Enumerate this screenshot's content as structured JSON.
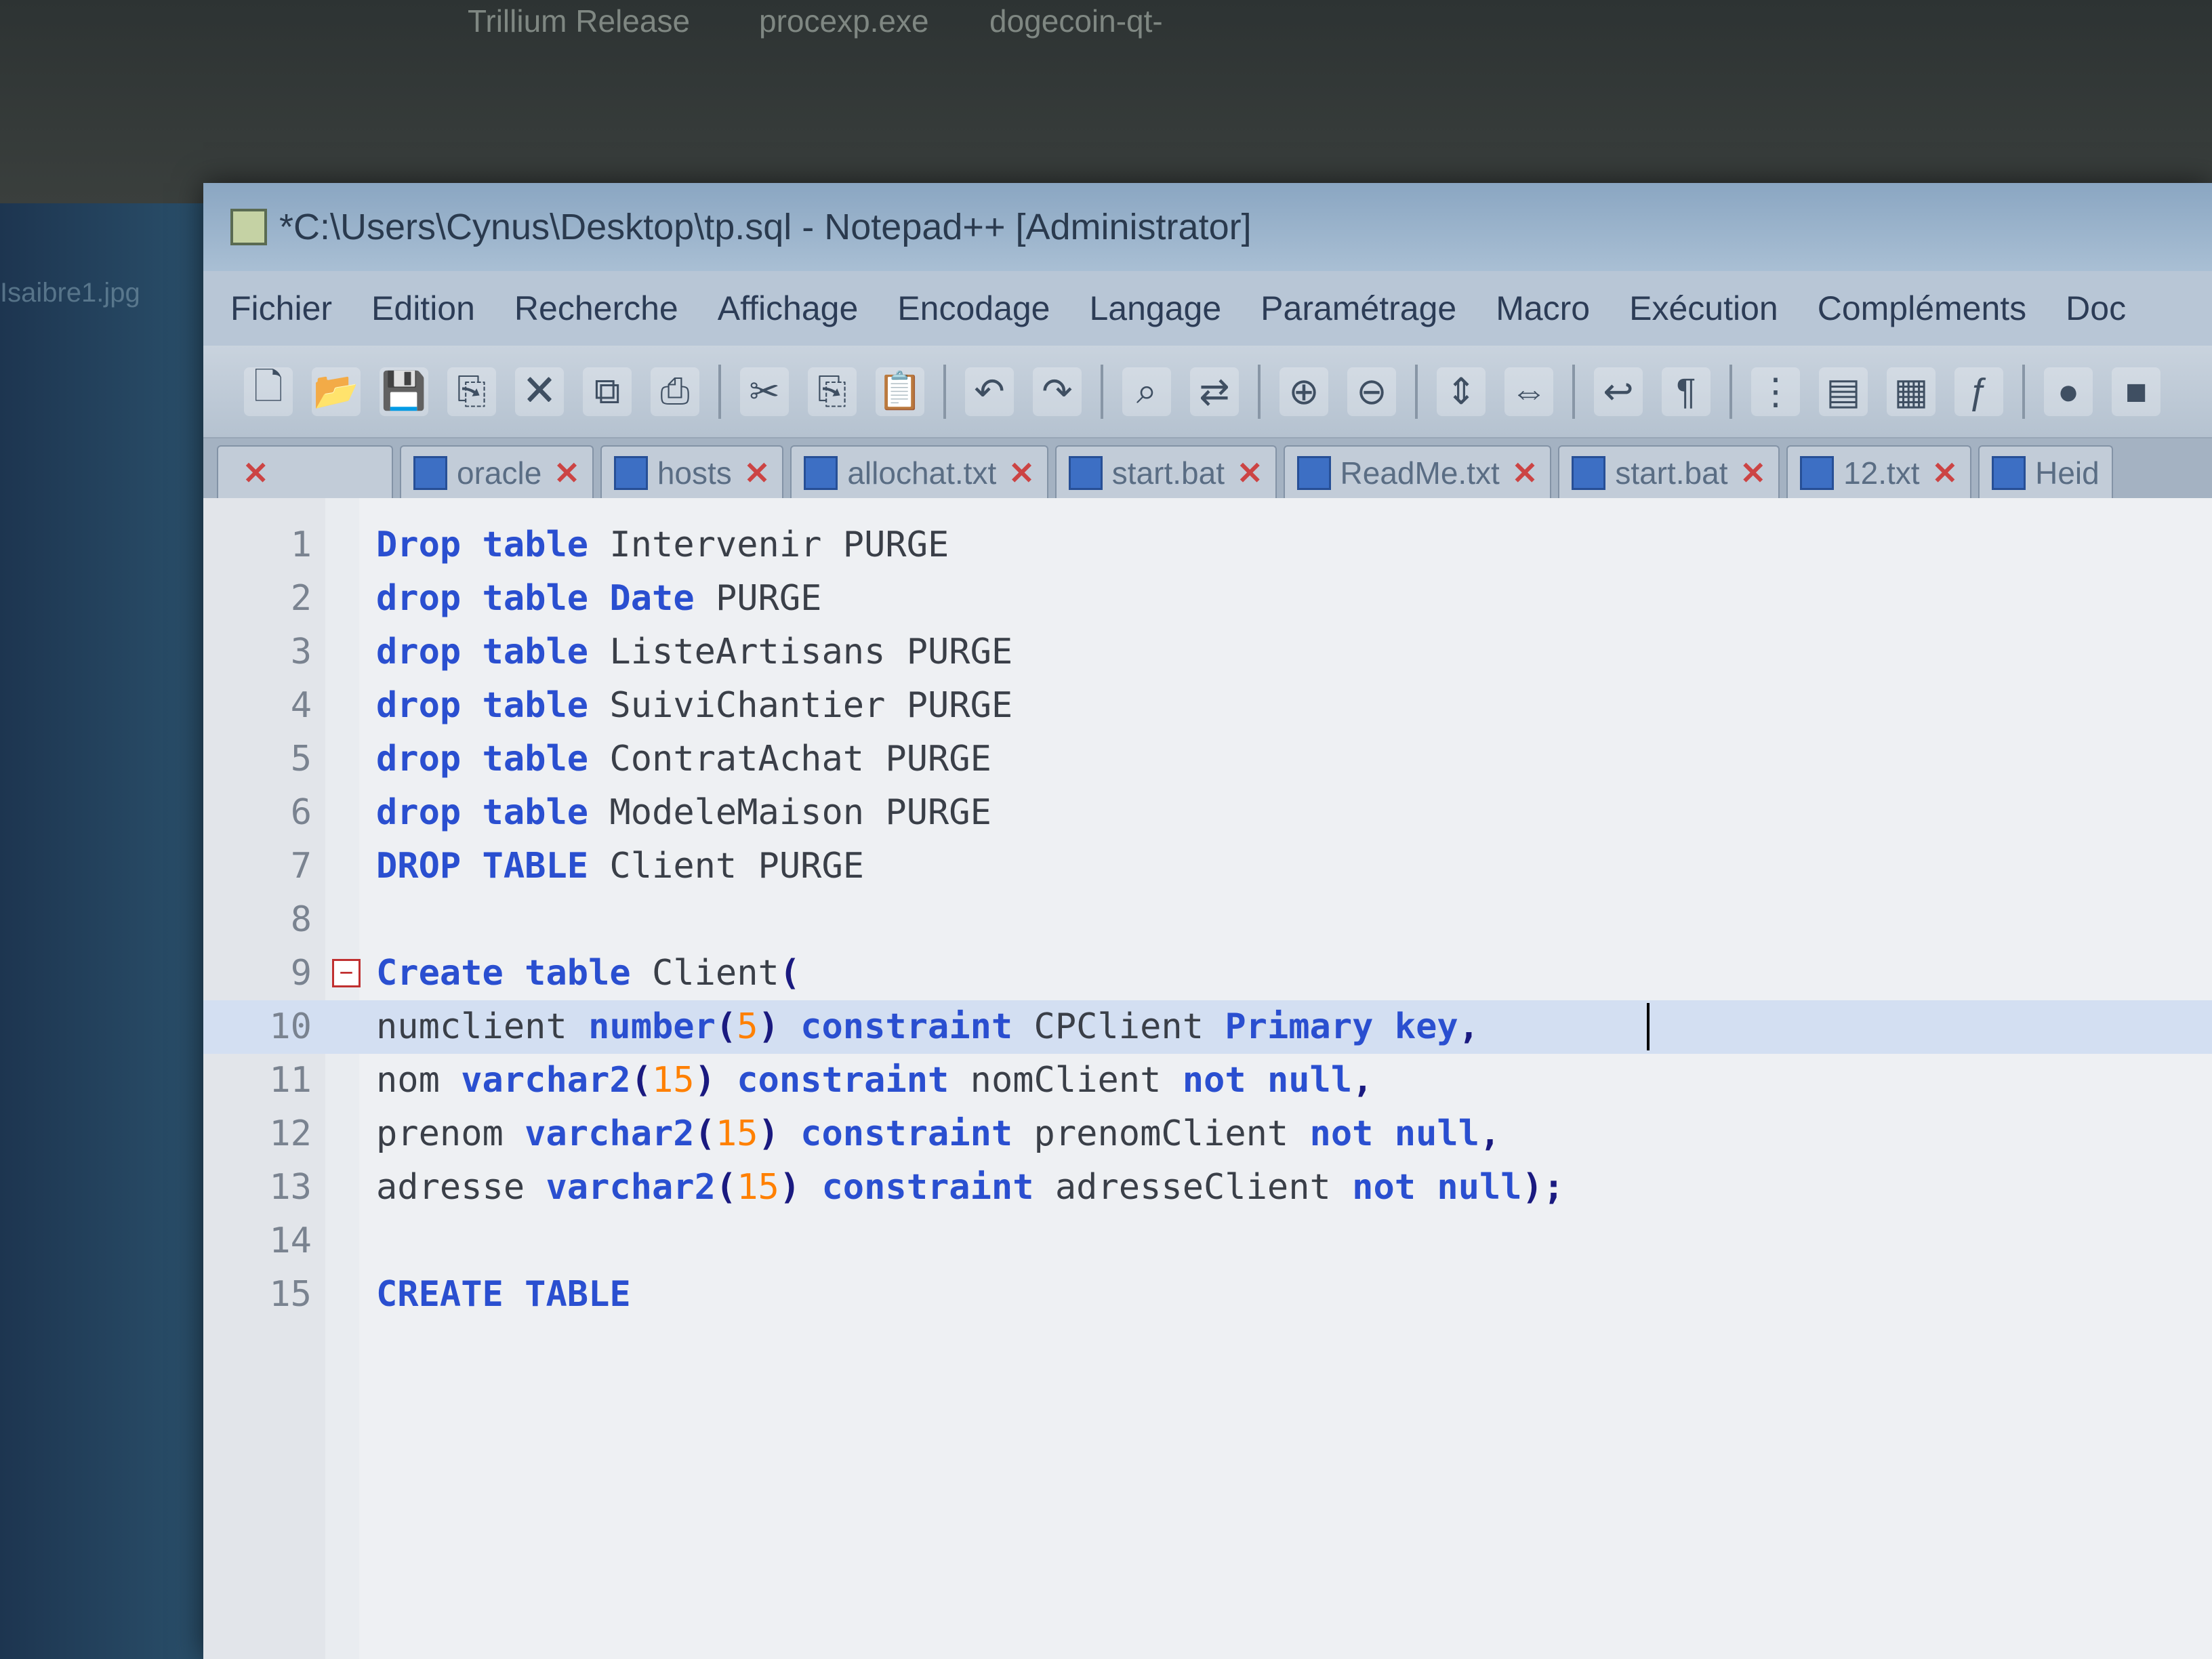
{
  "desktop": {
    "taskbar_items": [
      "Trillium Release",
      "procexp.exe",
      "dogecoin-qt-"
    ],
    "left_file": "Isaibre1.jpg"
  },
  "window": {
    "title": "*C:\\Users\\Cynus\\Desktop\\tp.sql - Notepad++ [Administrator]"
  },
  "menu": [
    "Fichier",
    "Edition",
    "Recherche",
    "Affichage",
    "Encodage",
    "Langage",
    "Paramétrage",
    "Macro",
    "Exécution",
    "Compléments",
    "Doc"
  ],
  "toolbar": {
    "icons": [
      "new-file-icon",
      "open-file-icon",
      "save-icon",
      "save-all-icon",
      "close-icon",
      "close-all-icon",
      "print-icon",
      "cut-icon",
      "copy-icon",
      "paste-icon",
      "undo-icon",
      "redo-icon",
      "find-icon",
      "replace-icon",
      "zoom-in-icon",
      "zoom-out-icon",
      "sync-v-icon",
      "sync-h-icon",
      "word-wrap-icon",
      "show-all-chars-icon",
      "indent-guide-icon",
      "udl-icon",
      "doc-map-icon",
      "function-list-icon",
      "record-macro-icon",
      "stop-macro-icon"
    ]
  },
  "tabs": [
    {
      "label": "",
      "close": "✕"
    },
    {
      "label": "oracle",
      "close": "✕"
    },
    {
      "label": "hosts",
      "close": "✕"
    },
    {
      "label": "allochat.txt",
      "close": "✕"
    },
    {
      "label": "start.bat",
      "close": "✕"
    },
    {
      "label": "ReadMe.txt",
      "close": "✕"
    },
    {
      "label": "start.bat",
      "close": "✕"
    },
    {
      "label": "12.txt",
      "close": "✕"
    },
    {
      "label": "Heid",
      "close": ""
    }
  ],
  "editor": {
    "current_line": 10,
    "lines": [
      {
        "n": "1",
        "tokens": [
          [
            "kw",
            "Drop"
          ],
          [
            "plain",
            " "
          ],
          [
            "kw",
            "table"
          ],
          [
            "plain",
            " Intervenir PURGE"
          ]
        ]
      },
      {
        "n": "2",
        "tokens": [
          [
            "kw",
            "drop"
          ],
          [
            "plain",
            " "
          ],
          [
            "kw",
            "table"
          ],
          [
            "plain",
            " "
          ],
          [
            "kw",
            "Date"
          ],
          [
            "plain",
            " PURGE"
          ]
        ]
      },
      {
        "n": "3",
        "tokens": [
          [
            "kw",
            "drop"
          ],
          [
            "plain",
            " "
          ],
          [
            "kw",
            "table"
          ],
          [
            "plain",
            " ListeArtisans PURGE"
          ]
        ]
      },
      {
        "n": "4",
        "tokens": [
          [
            "kw",
            "drop"
          ],
          [
            "plain",
            " "
          ],
          [
            "kw",
            "table"
          ],
          [
            "plain",
            " SuiviChantier PURGE"
          ]
        ]
      },
      {
        "n": "5",
        "tokens": [
          [
            "kw",
            "drop"
          ],
          [
            "plain",
            " "
          ],
          [
            "kw",
            "table"
          ],
          [
            "plain",
            " ContratAchat PURGE"
          ]
        ]
      },
      {
        "n": "6",
        "tokens": [
          [
            "kw",
            "drop"
          ],
          [
            "plain",
            " "
          ],
          [
            "kw",
            "table"
          ],
          [
            "plain",
            " ModeleMaison PURGE"
          ]
        ]
      },
      {
        "n": "7",
        "tokens": [
          [
            "kw",
            "DROP"
          ],
          [
            "plain",
            " "
          ],
          [
            "kw",
            "TABLE"
          ],
          [
            "plain",
            " Client PURGE"
          ]
        ]
      },
      {
        "n": "8",
        "tokens": []
      },
      {
        "n": "9",
        "fold": "−",
        "tokens": [
          [
            "kw",
            "Create"
          ],
          [
            "plain",
            " "
          ],
          [
            "kw",
            "table"
          ],
          [
            "plain",
            " Client"
          ],
          [
            "op",
            "("
          ]
        ]
      },
      {
        "n": "10",
        "tokens": [
          [
            "plain",
            "numclient "
          ],
          [
            "kw",
            "number"
          ],
          [
            "op",
            "("
          ],
          [
            "num",
            "5"
          ],
          [
            "op",
            ")"
          ],
          [
            "plain",
            " "
          ],
          [
            "kw",
            "constraint"
          ],
          [
            "plain",
            " CPClient "
          ],
          [
            "kw",
            "Primary"
          ],
          [
            "plain",
            " "
          ],
          [
            "kw",
            "key"
          ],
          [
            "op",
            ","
          ]
        ]
      },
      {
        "n": "11",
        "tokens": [
          [
            "plain",
            "nom "
          ],
          [
            "kw",
            "varchar2"
          ],
          [
            "op",
            "("
          ],
          [
            "num",
            "15"
          ],
          [
            "op",
            ")"
          ],
          [
            "plain",
            " "
          ],
          [
            "kw",
            "constraint"
          ],
          [
            "plain",
            " nomClient "
          ],
          [
            "kw",
            "not"
          ],
          [
            "plain",
            " "
          ],
          [
            "kw",
            "null"
          ],
          [
            "op",
            ","
          ]
        ]
      },
      {
        "n": "12",
        "tokens": [
          [
            "plain",
            "prenom "
          ],
          [
            "kw",
            "varchar2"
          ],
          [
            "op",
            "("
          ],
          [
            "num",
            "15"
          ],
          [
            "op",
            ")"
          ],
          [
            "plain",
            " "
          ],
          [
            "kw",
            "constraint"
          ],
          [
            "plain",
            " prenomClient "
          ],
          [
            "kw",
            "not"
          ],
          [
            "plain",
            " "
          ],
          [
            "kw",
            "null"
          ],
          [
            "op",
            ","
          ]
        ]
      },
      {
        "n": "13",
        "tokens": [
          [
            "plain",
            "adresse "
          ],
          [
            "kw",
            "varchar2"
          ],
          [
            "op",
            "("
          ],
          [
            "num",
            "15"
          ],
          [
            "op",
            ")"
          ],
          [
            "plain",
            " "
          ],
          [
            "kw",
            "constraint"
          ],
          [
            "plain",
            " adresseClient "
          ],
          [
            "kw",
            "not"
          ],
          [
            "plain",
            " "
          ],
          [
            "kw",
            "null"
          ],
          [
            "op",
            ");"
          ]
        ]
      },
      {
        "n": "14",
        "tokens": []
      },
      {
        "n": "15",
        "tokens": [
          [
            "kw",
            "CREATE"
          ],
          [
            "plain",
            " "
          ],
          [
            "kw",
            "TABLE"
          ]
        ]
      }
    ]
  }
}
